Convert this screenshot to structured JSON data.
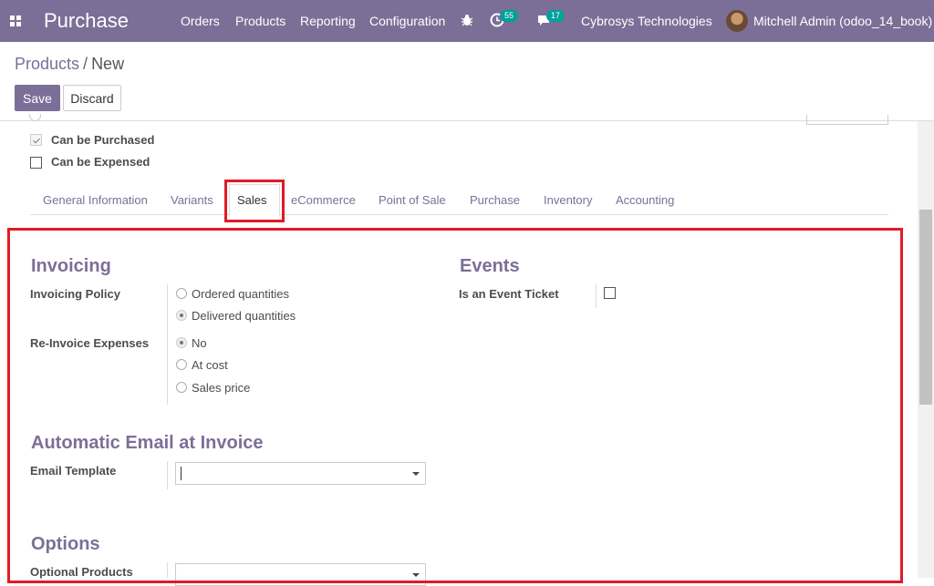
{
  "navbar": {
    "brand": "Purchase",
    "menus": [
      "Orders",
      "Products",
      "Reporting",
      "Configuration"
    ],
    "activity_count": "55",
    "message_count": "17",
    "company": "Cybrosys Technologies",
    "user": "Mitchell Admin (odoo_14_book)"
  },
  "breadcrumb": {
    "parent": "Products",
    "separator": "/",
    "current": "New"
  },
  "buttons": {
    "save": "Save",
    "discard": "Discard"
  },
  "options": {
    "can_be_purchased": {
      "label": "Can be Purchased",
      "checked": true
    },
    "can_be_expensed": {
      "label": "Can be Expensed",
      "checked": false
    }
  },
  "tabs": [
    "General Information",
    "Variants",
    "Sales",
    "eCommerce",
    "Point of Sale",
    "Purchase",
    "Inventory",
    "Accounting"
  ],
  "active_tab": "Sales",
  "invoicing": {
    "title": "Invoicing",
    "policy_label": "Invoicing Policy",
    "policy_options": [
      "Ordered quantities",
      "Delivered quantities"
    ],
    "policy_selected": "Delivered quantities",
    "reinvoice_label": "Re-Invoice Expenses",
    "reinvoice_options": [
      "No",
      "At cost",
      "Sales price"
    ],
    "reinvoice_selected": "No"
  },
  "events": {
    "title": "Events",
    "ticket_label": "Is an Event Ticket",
    "ticket_checked": false
  },
  "auto_email": {
    "title": "Automatic Email at Invoice",
    "template_label": "Email Template",
    "template_value": ""
  },
  "options_section": {
    "title": "Options",
    "optional_products_label": "Optional Products"
  },
  "colors": {
    "primary": "#7c6f97",
    "badge": "#00a09d",
    "highlight": "#e01b24"
  }
}
